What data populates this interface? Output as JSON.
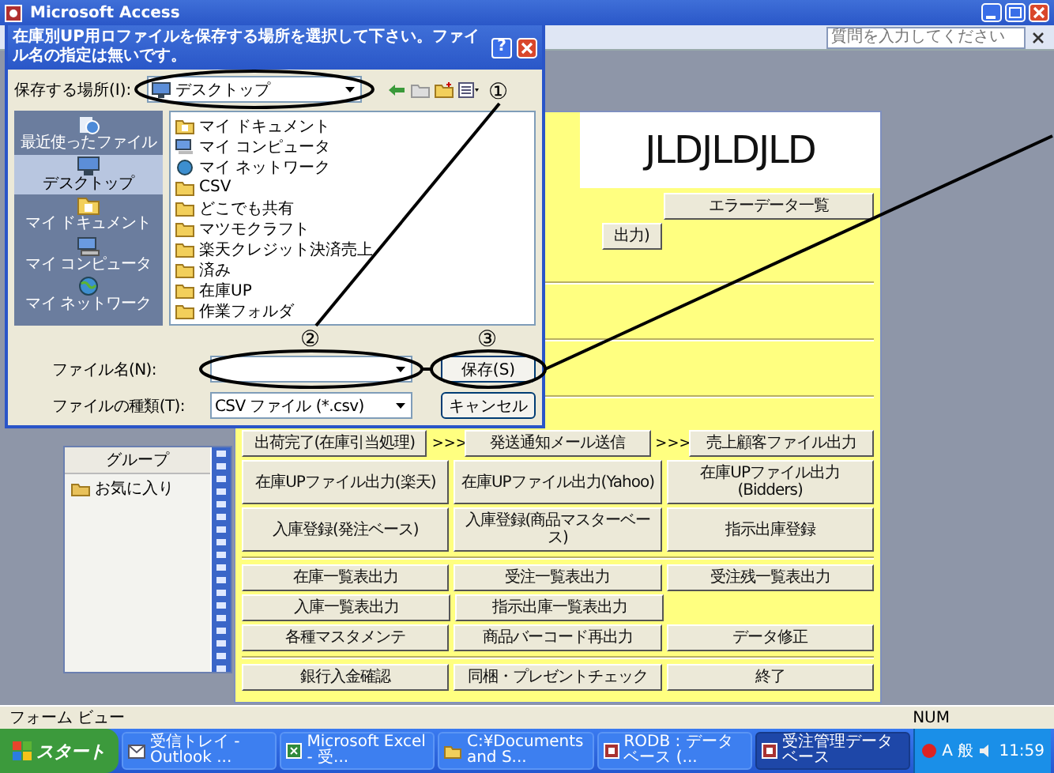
{
  "app_window": {
    "title": "Microsoft Access",
    "help_box": {
      "placeholder": "質問を入力してください"
    }
  },
  "database_window": {
    "group_header": "グループ",
    "items": [
      {
        "label": "お気に入り"
      }
    ]
  },
  "form": {
    "logo": "JLDJLDJLD",
    "sections": [
      {
        "rows": [
          [
            {
              "kind": "covered"
            },
            {
              "kind": "covered"
            },
            {
              "kind": "button",
              "label": "エラーデータ一覧"
            }
          ],
          [
            {
              "kind": "covered"
            },
            {
              "kind": "clipped",
              "label": "出力)"
            }
          ]
        ]
      },
      {
        "rows": [
          [
            {
              "kind": "button",
              "label": "出荷完了(在庫引当処理)",
              "next": ">>>"
            },
            {
              "kind": "button",
              "label": "発送通知メール送信",
              "next": ">>>"
            },
            {
              "kind": "button",
              "label": "売上顧客ファイル出力"
            }
          ],
          [
            {
              "kind": "button",
              "label": "在庫UPファイル出力(楽天)"
            },
            {
              "kind": "button",
              "label": "在庫UPファイル出力(Yahoo)"
            },
            {
              "kind": "button",
              "label": "在庫UPファイル出力(Bidders)"
            }
          ],
          [
            {
              "kind": "button",
              "label": "入庫登録(発注ベース)"
            },
            {
              "kind": "button",
              "label": "入庫登録(商品マスターベース)"
            },
            {
              "kind": "button",
              "label": "指示出庫登録"
            }
          ]
        ]
      },
      {
        "rows": [
          [
            {
              "kind": "button",
              "label": "在庫一覧表出力"
            },
            {
              "kind": "button",
              "label": "受注一覧表出力"
            },
            {
              "kind": "button",
              "label": "受注残一覧表出力"
            }
          ],
          [
            {
              "kind": "button",
              "label": "入庫一覧表出力"
            },
            {
              "kind": "button",
              "label": "指示出庫一覧表出力"
            }
          ],
          [
            {
              "kind": "button",
              "label": "各種マスタメンテ"
            },
            {
              "kind": "button",
              "label": "商品バーコード再出力"
            },
            {
              "kind": "button",
              "label": "データ修正"
            }
          ]
        ]
      },
      {
        "rows": [
          [
            {
              "kind": "button",
              "label": "銀行入金確認"
            },
            {
              "kind": "button",
              "label": "同梱・プレゼントチェック"
            },
            {
              "kind": "button",
              "label": "終了"
            }
          ]
        ]
      }
    ]
  },
  "dialog": {
    "title": "在庫別UP用ロファイルを保存する場所を選択して下さい。ファイル名の指定は無いです。",
    "help_button": "?",
    "save_in_label": "保存する場所(I):",
    "save_in_value": "デスクトップ",
    "places": [
      {
        "kind": "recent",
        "label": "最近使ったファイル",
        "selected": false
      },
      {
        "kind": "desktop",
        "label": "デスクトップ",
        "selected": true
      },
      {
        "kind": "documents",
        "label": "マイ ドキュメント",
        "selected": false
      },
      {
        "kind": "computer",
        "label": "マイ コンピュータ",
        "selected": false
      },
      {
        "kind": "network",
        "label": "マイ ネットワーク",
        "selected": false
      }
    ],
    "files": [
      {
        "kind": "documents",
        "name": "マイ ドキュメント"
      },
      {
        "kind": "computer",
        "name": "マイ コンピュータ"
      },
      {
        "kind": "network",
        "name": "マイ ネットワーク"
      },
      {
        "kind": "folder",
        "name": "CSV"
      },
      {
        "kind": "folder",
        "name": "どこでも共有"
      },
      {
        "kind": "folder",
        "name": "マツモクラフト"
      },
      {
        "kind": "folder",
        "name": "楽天クレジット決済売上"
      },
      {
        "kind": "folder",
        "name": "済み"
      },
      {
        "kind": "folder",
        "name": "在庫UP"
      },
      {
        "kind": "folder",
        "name": "作業フォルダ"
      }
    ],
    "file_name_label": "ファイル名(N):",
    "file_type_label": "ファイルの種類(T):",
    "file_type_value": "CSV ファイル (*.csv)",
    "buttons": [
      "保存(S)",
      "キャンセル"
    ]
  },
  "annotations": [
    {
      "label": "①"
    },
    {
      "label": "②"
    },
    {
      "label": "③"
    }
  ],
  "status_bar": {
    "mode": "フォーム ビュー",
    "indicator": "NUM"
  },
  "taskbar": {
    "start": "スタート",
    "tasks": [
      {
        "kind": "mail",
        "label": "受信トレイ - Outlook ...",
        "selected": false
      },
      {
        "kind": "sheet",
        "label": "Microsoft Excel - 受...",
        "selected": false
      },
      {
        "kind": "folder",
        "label": "C:¥Documents and S...",
        "selected": false
      },
      {
        "kind": "database",
        "label": "RODB : データベース (...",
        "selected": false
      },
      {
        "kind": "database",
        "label": "受注管理データベース",
        "selected": true
      }
    ],
    "ime": "A 般",
    "time": "11:59"
  }
}
